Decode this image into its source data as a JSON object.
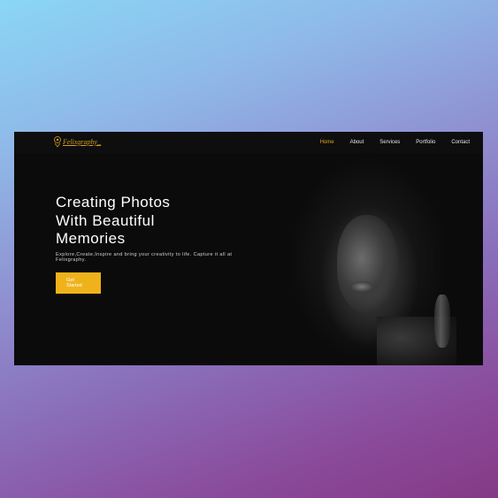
{
  "brand": {
    "name": "Felixgraphy_"
  },
  "nav": {
    "items": [
      "Home",
      "About",
      "Services",
      "Portfolio",
      "Contact"
    ],
    "active": "Home"
  },
  "hero": {
    "line1": "Creating Photos",
    "line2": "With Beautiful",
    "line3": "Memories",
    "subtext": "Explore,Create,Inspire and bring your creativity to life. Capture it all at Felixgraphy.",
    "cta": "Get Started"
  },
  "colors": {
    "accent": "#f0b21b",
    "background": "#0b0b0c",
    "text": "#ffffff"
  }
}
